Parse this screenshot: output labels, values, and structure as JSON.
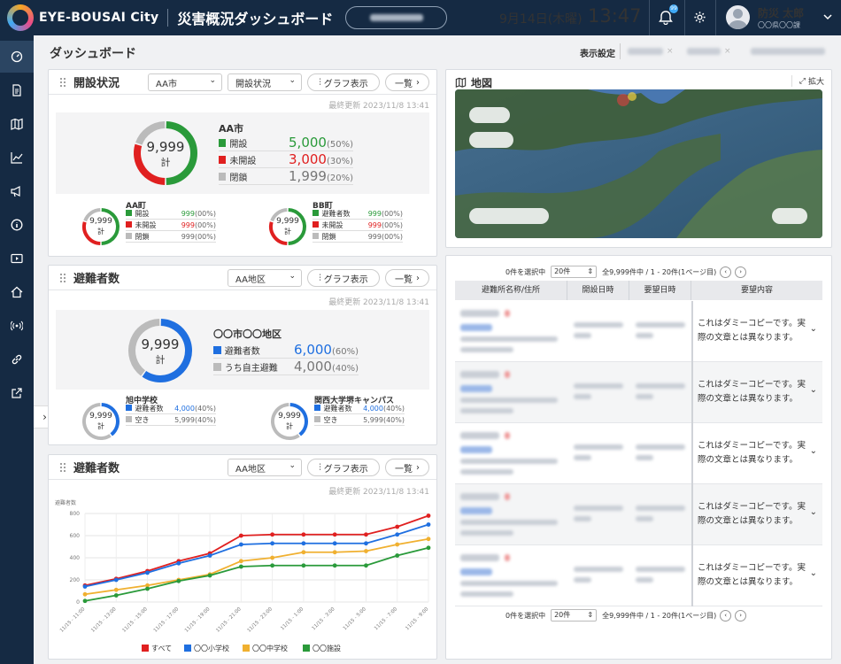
{
  "header": {
    "logo": "EYE-BOUSAI City",
    "title": "災害概況ダッシュボード",
    "date": "9月14日(木曜)",
    "time": "13:47",
    "badge": "99",
    "user_name": "防災 太郎",
    "user_dept": "〇〇県〇〇課"
  },
  "page": {
    "title": "ダッシュボード",
    "display_settings": "表示設定"
  },
  "kaisetsu": {
    "title": "開設状況",
    "select_city": "AA市",
    "select_status": "開設状況",
    "graph_btn": "グラフ表示",
    "list_btn": "一覧",
    "updated": "最終更新 2023/11/8 13:41",
    "main": {
      "name": "AA市",
      "total": "9,999",
      "total_label": "計",
      "rows": [
        {
          "label": "開設",
          "value": "5,000",
          "pct": "(50%)"
        },
        {
          "label": "未開設",
          "value": "3,000",
          "pct": "(30%)"
        },
        {
          "label": "閉鎖",
          "value": "1,999",
          "pct": "(20%)"
        }
      ],
      "fractions": [
        0.5,
        0.3,
        0.2
      ]
    },
    "subs": [
      {
        "name": "AA町",
        "total": "9,999",
        "total_label": "計",
        "rows": [
          {
            "label": "開設",
            "value": "999",
            "pct": "(00%)"
          },
          {
            "label": "未開設",
            "value": "999",
            "pct": "(00%)"
          },
          {
            "label": "閉鎖",
            "value": "999",
            "pct": "(00%)"
          }
        ]
      },
      {
        "name": "BB町",
        "total": "9,999",
        "total_label": "計",
        "rows": [
          {
            "label": "避難者数",
            "value": "999",
            "pct": "(00%)"
          },
          {
            "label": "未開設",
            "value": "999",
            "pct": "(00%)"
          },
          {
            "label": "閉鎖",
            "value": "999",
            "pct": "(00%)"
          }
        ]
      }
    ]
  },
  "hinan1": {
    "title": "避難者数",
    "select_area": "AA地区",
    "graph_btn": "グラフ表示",
    "list_btn": "一覧",
    "updated": "最終更新 2023/11/8 13:41",
    "main": {
      "name": "〇〇市〇〇地区",
      "total": "9,999",
      "total_label": "計",
      "rows": [
        {
          "label": "避難者数",
          "value": "6,000",
          "pct": "(60%)"
        },
        {
          "label": "うち自主避難",
          "value": "4,000",
          "pct": "(40%)"
        }
      ],
      "fraction": 0.6
    },
    "subs": [
      {
        "name": "旭中学校",
        "total": "9,999",
        "total_label": "計",
        "rows": [
          {
            "label": "避難者数",
            "value": "4,000",
            "pct": "(40%)"
          },
          {
            "label": "空き",
            "value": "5,999",
            "pct": "(40%)"
          }
        ]
      },
      {
        "name": "関西大学堺キャンパス",
        "total": "9,999",
        "total_label": "計",
        "rows": [
          {
            "label": "避難者数",
            "value": "4,000",
            "pct": "(40%)"
          },
          {
            "label": "空き",
            "value": "5,999",
            "pct": "(40%)"
          }
        ]
      }
    ]
  },
  "hinan2": {
    "title": "避難者数",
    "select_area": "AA地区",
    "graph_btn": "グラフ表示",
    "list_btn": "一覧",
    "updated": "最終更新 2023/11/8 13:41"
  },
  "chart_data": {
    "type": "line",
    "ylabel": "避難者数",
    "ylim": [
      0,
      800
    ],
    "yticks": [
      0,
      200,
      400,
      600,
      800
    ],
    "categories": [
      "11/15 - 11:00",
      "11/15 - 13:00",
      "11/15 - 15:00",
      "11/15 - 17:00",
      "11/15 - 19:00",
      "11/15 - 21:00",
      "11/15 - 23:00",
      "11/15 - 1:00",
      "11/15 - 3:00",
      "11/15 - 5:00",
      "11/15 - 7:00",
      "11/15 - 9:00"
    ],
    "series": [
      {
        "name": "すべて",
        "color": "#e02020",
        "values": [
          150,
          210,
          280,
          370,
          440,
          600,
          610,
          610,
          610,
          610,
          680,
          780
        ]
      },
      {
        "name": "〇〇小学校",
        "color": "#1f6fe0",
        "values": [
          140,
          200,
          265,
          350,
          420,
          520,
          530,
          530,
          530,
          530,
          610,
          700
        ]
      },
      {
        "name": "〇〇中学校",
        "color": "#f0b030",
        "values": [
          70,
          110,
          150,
          200,
          250,
          370,
          400,
          450,
          450,
          460,
          520,
          570
        ]
      },
      {
        "name": "〇〇施設",
        "color": "#2a9a3a",
        "values": [
          10,
          60,
          120,
          190,
          240,
          320,
          330,
          330,
          330,
          330,
          420,
          490
        ]
      }
    ]
  },
  "map": {
    "title": "地図",
    "expand": "拡大"
  },
  "table": {
    "selected": "0件を選択中",
    "per_page": "20件",
    "summary": "全9,999件中 / 1 - 20件(1ページ目)",
    "columns": [
      "避難所名称/住所",
      "開設日時",
      "要望日時",
      "要望内容"
    ],
    "rows": [
      {
        "content": "これはダミーコピーです。実際の文章とは異なります。"
      },
      {
        "content": "これはダミーコピーです。実際の文章とは異なります。"
      },
      {
        "content": "これはダミーコピーです。実際の文章とは異なります。"
      },
      {
        "content": "これはダミーコピーです。実際の文章とは異なります。"
      },
      {
        "content": "これはダミーコピーです。実際の文章とは異なります。"
      }
    ]
  }
}
